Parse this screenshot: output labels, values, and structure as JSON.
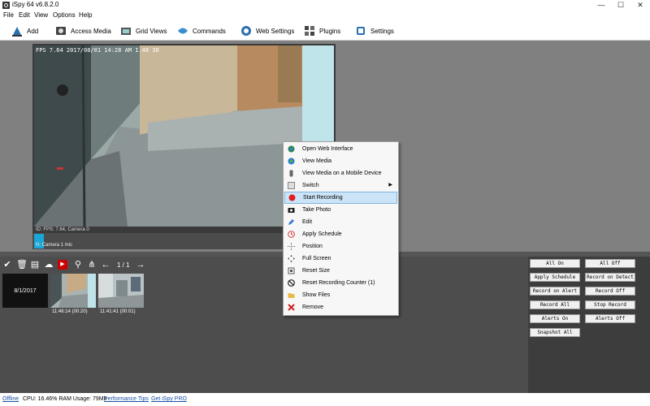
{
  "window": {
    "title": "iSpy 64 v6.8.2.0",
    "minimize": "—",
    "maximize": "☐",
    "close": "✕"
  },
  "menu": {
    "items": [
      "File",
      "Edit",
      "View",
      "Options",
      "Help"
    ]
  },
  "toolbar": {
    "items": [
      {
        "label": "Add",
        "icon": "add-camera-icon"
      },
      {
        "label": "Access Media",
        "icon": "access-media-icon"
      },
      {
        "label": "Grid Views",
        "icon": "grid-views-icon"
      },
      {
        "label": "Commands",
        "icon": "commands-icon"
      },
      {
        "label": "Web Settings",
        "icon": "web-settings-icon"
      },
      {
        "label": "Plugins",
        "icon": "plugins-icon"
      },
      {
        "label": "Settings",
        "icon": "settings-icon"
      }
    ]
  },
  "camera": {
    "osd": "FPS 7.64 2017/08/01 14:28 AM  1.48 38",
    "status": "ID: FPS: 7.64, Camera 0",
    "mic_label": "N: Camera 1 mic"
  },
  "media": {
    "page_indicator": "1 / 1",
    "date": "8/1/2017",
    "thumbnails": [
      {
        "time": "11:46:14 (00:20)"
      },
      {
        "time": "11:41:41 (00:01)"
      }
    ]
  },
  "controls": {
    "buttons": [
      "All On",
      "All Off",
      "Apply Schedule",
      "Record on Detect",
      "Record on Alert",
      "Record Off",
      "Record All",
      "Stop Record",
      "Alerts On",
      "Alerts Off",
      "Snapshot All"
    ]
  },
  "context_menu": {
    "items": [
      {
        "label": "Open Web Interface",
        "icon": "globe-icon"
      },
      {
        "label": "View Media",
        "icon": "globe-media-icon"
      },
      {
        "label": "View Media on a Mobile Device",
        "icon": "mobile-icon"
      },
      {
        "label": "Switch",
        "icon": "switch-icon",
        "submenu": true
      },
      {
        "label": "Start Recording",
        "icon": "record-icon",
        "highlighted": true
      },
      {
        "label": "Take Photo",
        "icon": "camera-icon"
      },
      {
        "label": "Edit",
        "icon": "edit-icon"
      },
      {
        "label": "Apply Schedule",
        "icon": "schedule-icon"
      },
      {
        "label": "Position",
        "icon": "position-icon"
      },
      {
        "label": "Full Screen",
        "icon": "fullscreen-icon"
      },
      {
        "label": "Reset Size",
        "icon": "reset-size-icon"
      },
      {
        "label": "Reset Recording Counter (1)",
        "icon": "reset-counter-icon"
      },
      {
        "label": "Show Files",
        "icon": "folder-icon"
      },
      {
        "label": "Remove",
        "icon": "remove-icon"
      }
    ],
    "submenu_arrow": "▶"
  },
  "statusbar": {
    "offline": "Offline",
    "usage": "CPU: 16.46% RAM Usage: 79Mb",
    "performance_tips": "Performance Tips",
    "get_ispy_pro": "Get iSpy PRO"
  },
  "colors": {
    "accent": "#1aa6d6",
    "highlight": "#cce4f7",
    "panel": "#4d4d4d"
  }
}
